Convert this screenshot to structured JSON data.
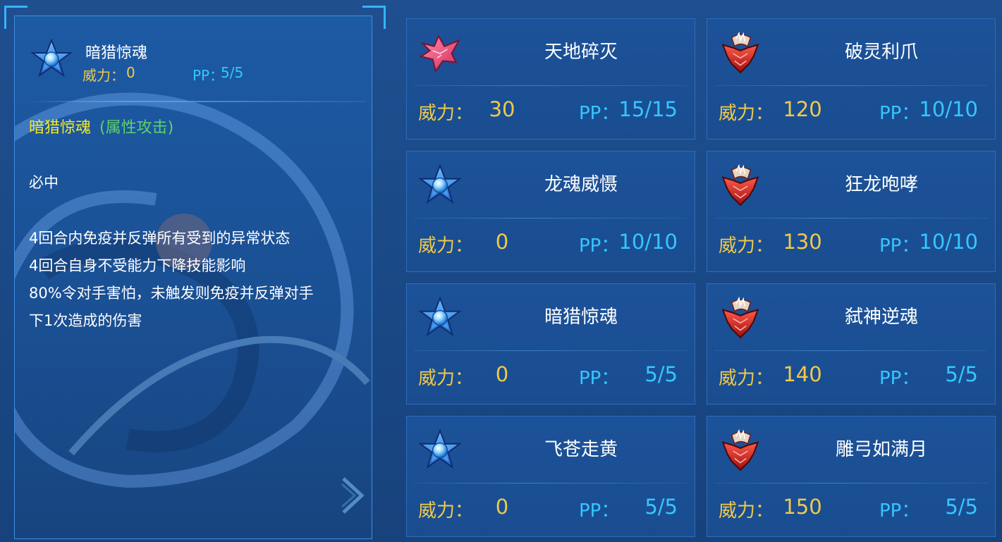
{
  "detail": {
    "name": "暗猎惊魂",
    "power_label": "威力：",
    "power": "0",
    "pp_label": "PP：",
    "pp": "5/5",
    "title_name": "暗猎惊魂",
    "title_category": "(属性攻击)",
    "hit": "必中",
    "effects": [
      "4回合内免疫并反弹所有受到的异常状态",
      "4回合自身不受能力下降技能影响",
      "80%令对手害怕，未触发则免疫并反弹对手",
      "下1次造成的伤害"
    ],
    "icon": "blue-star-icon"
  },
  "labels": {
    "power": "威力：",
    "pp": "PP："
  },
  "skills": [
    {
      "name": "天地碎灭",
      "power": "30",
      "pp": "15/15",
      "icon": "pink-crystal-icon"
    },
    {
      "name": "破灵利爪",
      "power": "120",
      "pp": "10/10",
      "icon": "red-claw-icon"
    },
    {
      "name": "龙魂威慑",
      "power": "0",
      "pp": "10/10",
      "icon": "blue-star-icon"
    },
    {
      "name": "狂龙咆哮",
      "power": "130",
      "pp": "10/10",
      "icon": "red-claw-icon"
    },
    {
      "name": "暗猎惊魂",
      "power": "0",
      "pp": "5/5",
      "icon": "blue-star-icon"
    },
    {
      "name": "弑神逆魂",
      "power": "140",
      "pp": "5/5",
      "icon": "red-claw-icon"
    },
    {
      "name": "飞苍走黄",
      "power": "0",
      "pp": "5/5",
      "icon": "blue-star-icon"
    },
    {
      "name": "雕弓如满月",
      "power": "150",
      "pp": "5/5",
      "icon": "red-claw-icon"
    }
  ],
  "colors": {
    "power": "#f0c94a",
    "pp": "#36c6ff",
    "title_name": "#f3ea2c",
    "title_category": "#5cd26a",
    "frame": "#36b3ff"
  }
}
